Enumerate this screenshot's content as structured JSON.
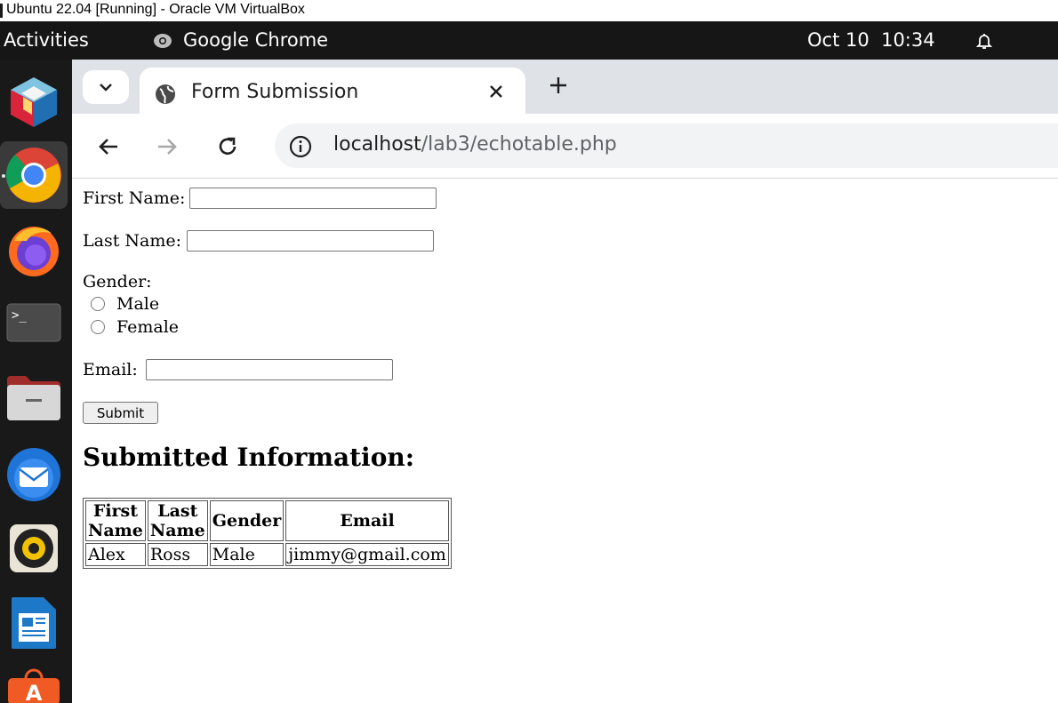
{
  "vm_window": {
    "title": "Ubuntu 22.04 [Running] - Oracle VM VirtualBox"
  },
  "topbar": {
    "activities": "Activities",
    "app_name": "Google Chrome",
    "date": "Oct 10",
    "time": "10:34"
  },
  "dock": {
    "items": [
      "virtualbox-icon",
      "chrome-icon",
      "firefox-icon",
      "terminal-icon",
      "files-icon",
      "thunderbird-icon",
      "rhythmbox-icon",
      "writer-icon",
      "app-center-icon"
    ]
  },
  "browser": {
    "tab_title": "Form Submission",
    "url_host": "localhost",
    "url_path": "/lab3/echotable.php"
  },
  "form": {
    "first_name_label": "First Name:",
    "first_name_value": "",
    "last_name_label": "Last Name:",
    "last_name_value": "",
    "gender_label": "Gender:",
    "gender_options": [
      "Male",
      "Female"
    ],
    "email_label": "Email:",
    "email_value": "",
    "submit_label": "Submit"
  },
  "result": {
    "heading": "Submitted Information:",
    "columns": [
      "First Name",
      "Last Name",
      "Gender",
      "Email"
    ],
    "rows": [
      [
        "Alex",
        "Ross",
        "Male",
        "jimmy@gmail.com"
      ]
    ]
  }
}
